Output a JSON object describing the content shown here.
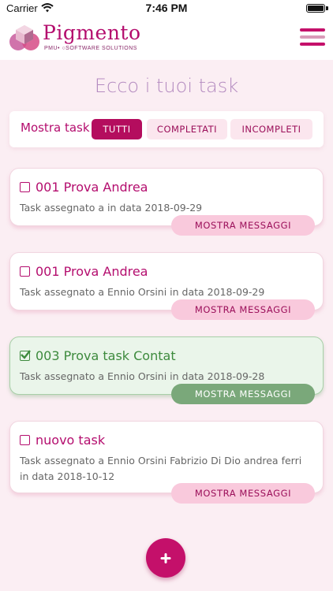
{
  "status_bar": {
    "carrier": "Carrier",
    "time": "7:46 PM"
  },
  "header": {
    "brand": "Pigmento",
    "tagline": "PMU• ○SOFTWARE SOLUTIONS",
    "menu_icon": "hamburger-icon",
    "colors": {
      "brand": "#b40d6e",
      "menu_lines": [
        "#c4106a",
        "#d99ab8",
        "#c4106a"
      ]
    }
  },
  "page": {
    "title": "Ecco i tuoi task"
  },
  "filter": {
    "label": "Mostra task",
    "options": [
      "TUTTI",
      "COMPLETATI",
      "INCOMPLETI"
    ],
    "selected": "TUTTI"
  },
  "tasks": [
    {
      "title": "001 Prova Andrea",
      "subtitle": "Task assegnato a in data 2018-09-29",
      "completed": false,
      "button": "MOSTRA MESSAGGI"
    },
    {
      "title": "001 Prova Andrea",
      "subtitle": "Task assegnato a Ennio Orsini in data 2018-09-29",
      "completed": false,
      "button": "MOSTRA MESSAGGI"
    },
    {
      "title": "003 Prova task Contat",
      "subtitle": "Task assegnato a Ennio Orsini in data 2018-09-28",
      "completed": true,
      "button": "MOSTRA MESSAGGI"
    },
    {
      "title": "nuovo task",
      "subtitle": "Task assegnato a Ennio Orsini Fabrizio Di Dio andrea ferri in data 2018-10-12",
      "completed": false,
      "button": "MOSTRA MESSAGGI"
    }
  ],
  "fab": {
    "icon": "plus-icon",
    "color": "#c4106a"
  },
  "colors": {
    "accent": "#b40d6e",
    "completed": "#3d8a3d",
    "background": "#fbeef3"
  }
}
